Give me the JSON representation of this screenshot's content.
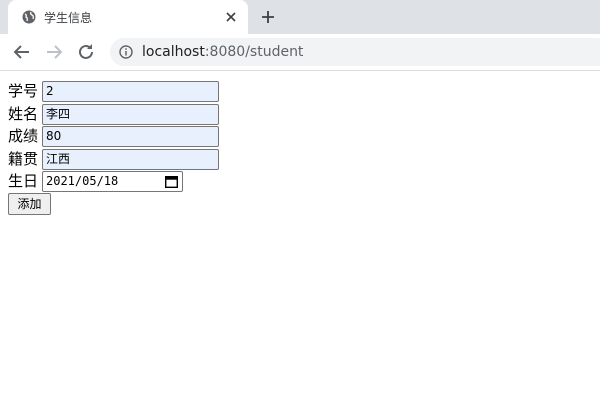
{
  "browser": {
    "tab_title": "学生信息",
    "url_host": "localhost",
    "url_path": ":8080/student"
  },
  "form": {
    "fields": [
      {
        "label": "学号",
        "value": "2"
      },
      {
        "label": "姓名",
        "value": "李四"
      },
      {
        "label": "成绩",
        "value": "80"
      },
      {
        "label": "籍贯",
        "value": "江西"
      },
      {
        "label": "生日",
        "value": "2021/05/18"
      }
    ],
    "submit_label": "添加"
  },
  "icons": {
    "favicon": "globe-icon",
    "tab_close": "close-icon",
    "new_tab": "plus-icon",
    "back": "arrow-left-icon",
    "forward": "arrow-right-icon",
    "reload": "reload-icon",
    "site_info": "info-icon",
    "date_picker": "calendar-icon"
  },
  "colors": {
    "autofill_bg": "#e8f0fe",
    "tabstrip_bg": "#dee1e6",
    "omnibox_bg": "#f1f3f4"
  }
}
